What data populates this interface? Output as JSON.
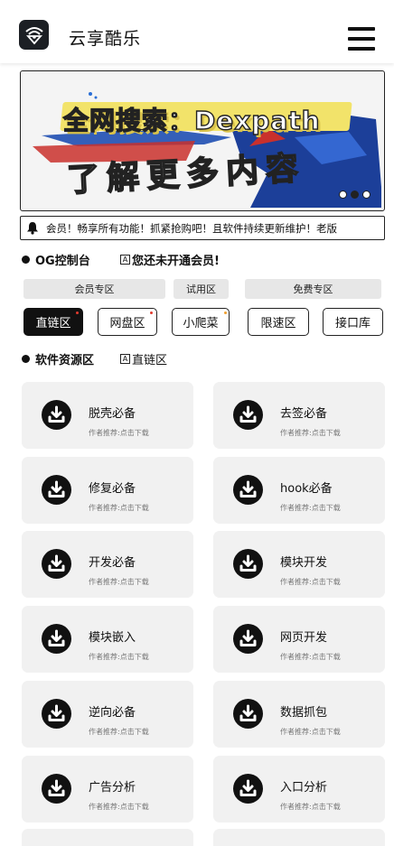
{
  "header": {
    "title": "云享酷乐",
    "logo_icon": "wifi-shield-icon",
    "menu_icon": "menu-icon"
  },
  "banner": {
    "line1": "全网搜索：Dexpath",
    "line2": "了解更多内容",
    "slides": 3,
    "active_slide": 2
  },
  "notice": {
    "icon": "bell-icon",
    "text": "会员！畅享所有功能！抓紧抢购吧！且软件持续更新维护！老版 "
  },
  "og": {
    "title": "OG控制台",
    "status_icon": "A",
    "status": "您还未开通会员!"
  },
  "zones": [
    "会员专区",
    "试用区",
    "免费专区"
  ],
  "categories": [
    {
      "label": "直链区",
      "active": true
    },
    {
      "label": "网盘区",
      "active": false
    },
    {
      "label": "小爬菜",
      "active": false
    },
    {
      "label": "限速区",
      "active": false
    },
    {
      "label": "接口库",
      "active": false
    }
  ],
  "resource": {
    "title": "软件资源区",
    "current_icon": "A",
    "current": "直链区"
  },
  "card_subtitle": "作者推荐:点击下载",
  "cards": [
    {
      "title": "脱壳必备",
      "subtitle": "作者推荐:点击下载"
    },
    {
      "title": "去签必备",
      "subtitle": "作者推荐:点击下载"
    },
    {
      "title": "修复必备",
      "subtitle": "作者推荐:点击下载"
    },
    {
      "title": "hook必备",
      "subtitle": "作者推荐:点击下载"
    },
    {
      "title": "开发必备",
      "subtitle": "作者推荐:点击下载"
    },
    {
      "title": "模块开发",
      "subtitle": "作者推荐:点击下载"
    },
    {
      "title": "模块嵌入",
      "subtitle": "作者推荐:点击下载"
    },
    {
      "title": "网页开发",
      "subtitle": "作者推荐:点击下载"
    },
    {
      "title": "逆向必备",
      "subtitle": "作者推荐:点击下载"
    },
    {
      "title": "数据抓包",
      "subtitle": "作者推荐:点击下载"
    },
    {
      "title": "广告分析",
      "subtitle": "作者推荐:点击下载"
    },
    {
      "title": "入口分析",
      "subtitle": "作者推荐:点击下载"
    }
  ]
}
